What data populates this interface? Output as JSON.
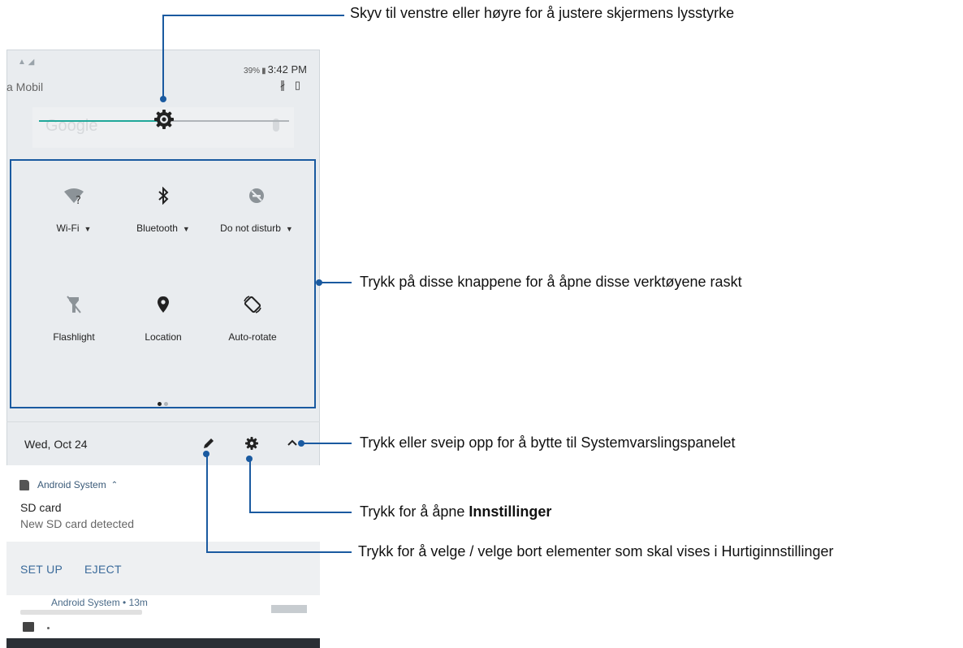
{
  "status_bar": {
    "battery": "39%",
    "time": "3:42 PM",
    "carrier": "a Mobil"
  },
  "search_ghost": "Google",
  "brightness": {
    "level": 0.5
  },
  "tiles": [
    {
      "label": "Wi-Fi",
      "icon": "wifi-icon",
      "has_menu": true
    },
    {
      "label": "Bluetooth",
      "icon": "bluetooth-icon",
      "has_menu": true
    },
    {
      "label": "Do not disturb",
      "icon": "do-not-disturb-icon",
      "has_menu": true
    },
    {
      "label": "Flashlight",
      "icon": "flashlight-icon",
      "has_menu": false
    },
    {
      "label": "Location",
      "icon": "location-icon",
      "has_menu": false
    },
    {
      "label": "Auto-rotate",
      "icon": "auto-rotate-icon",
      "has_menu": false
    }
  ],
  "page_dots": {
    "count": 2,
    "active": 0
  },
  "date_row": {
    "date": "Wed, Oct 24"
  },
  "notification": {
    "app": "Android System",
    "title": "SD card",
    "body": "New SD card detected",
    "actions": [
      "SET UP",
      "EJECT"
    ],
    "second_app": "Android System • 13m"
  },
  "callouts": {
    "brightness": "Skyv til venstre eller høyre for å justere skjermens lysstyrke",
    "tiles": "Trykk på disse knappene for å åpne disse verktøyene raskt",
    "collapse": "Trykk eller sveip opp for å bytte til Systemvarslingspanelet",
    "settings_prefix": "Trykk for å åpne ",
    "settings_bold": "Innstillinger",
    "edit": "Trykk for å velge / velge bort elementer som skal vises i Hurtiginnstillinger"
  },
  "colors": {
    "accent": "#1a5aa0",
    "slider": "#20a89a",
    "panel": "#e9ecef"
  }
}
